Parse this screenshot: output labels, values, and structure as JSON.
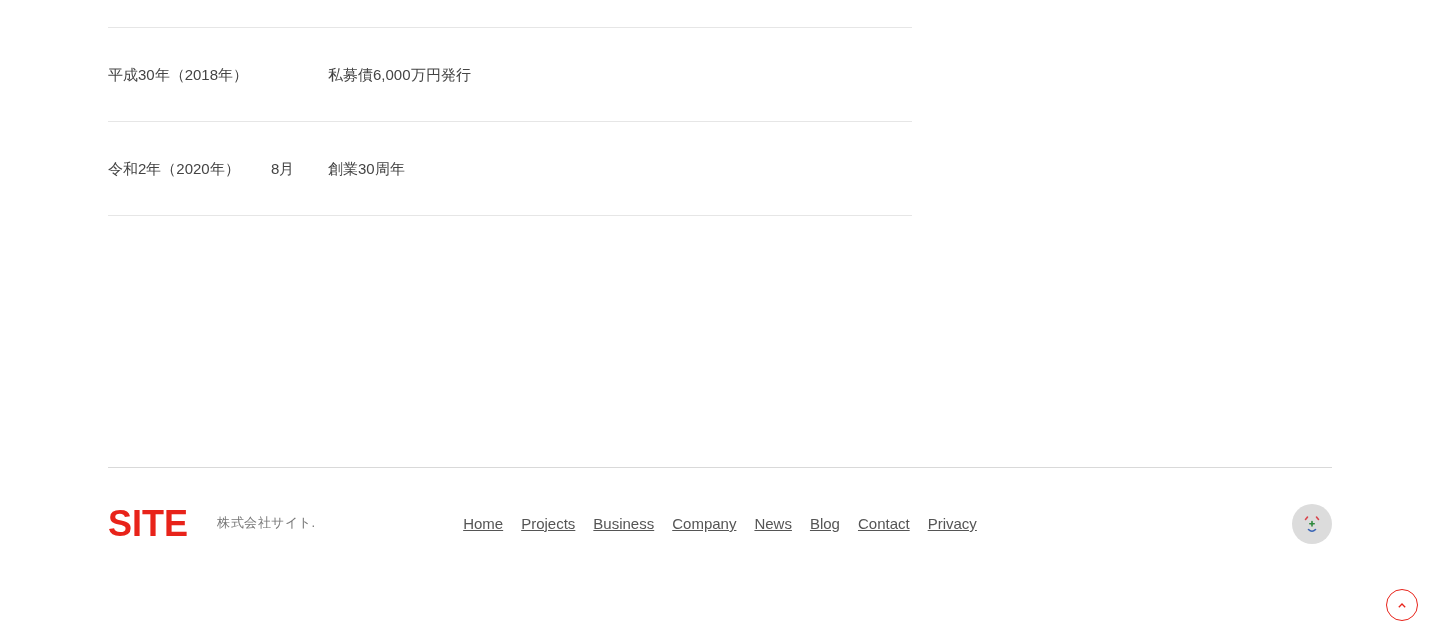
{
  "history": {
    "rows": [
      {
        "date": "平成30年（2018年）",
        "event": "私募債6,000万円発行"
      },
      {
        "date": "令和2年（2020年）",
        "month": "8月",
        "event": "創業30周年"
      }
    ]
  },
  "footer": {
    "logo": "SITE",
    "company": "株式会社サイト.",
    "nav": [
      {
        "label": "Home"
      },
      {
        "label": "Projects"
      },
      {
        "label": "Business"
      },
      {
        "label": "Company"
      },
      {
        "label": "News"
      },
      {
        "label": "Blog"
      },
      {
        "label": "Contact"
      },
      {
        "label": "Privacy"
      }
    ]
  }
}
